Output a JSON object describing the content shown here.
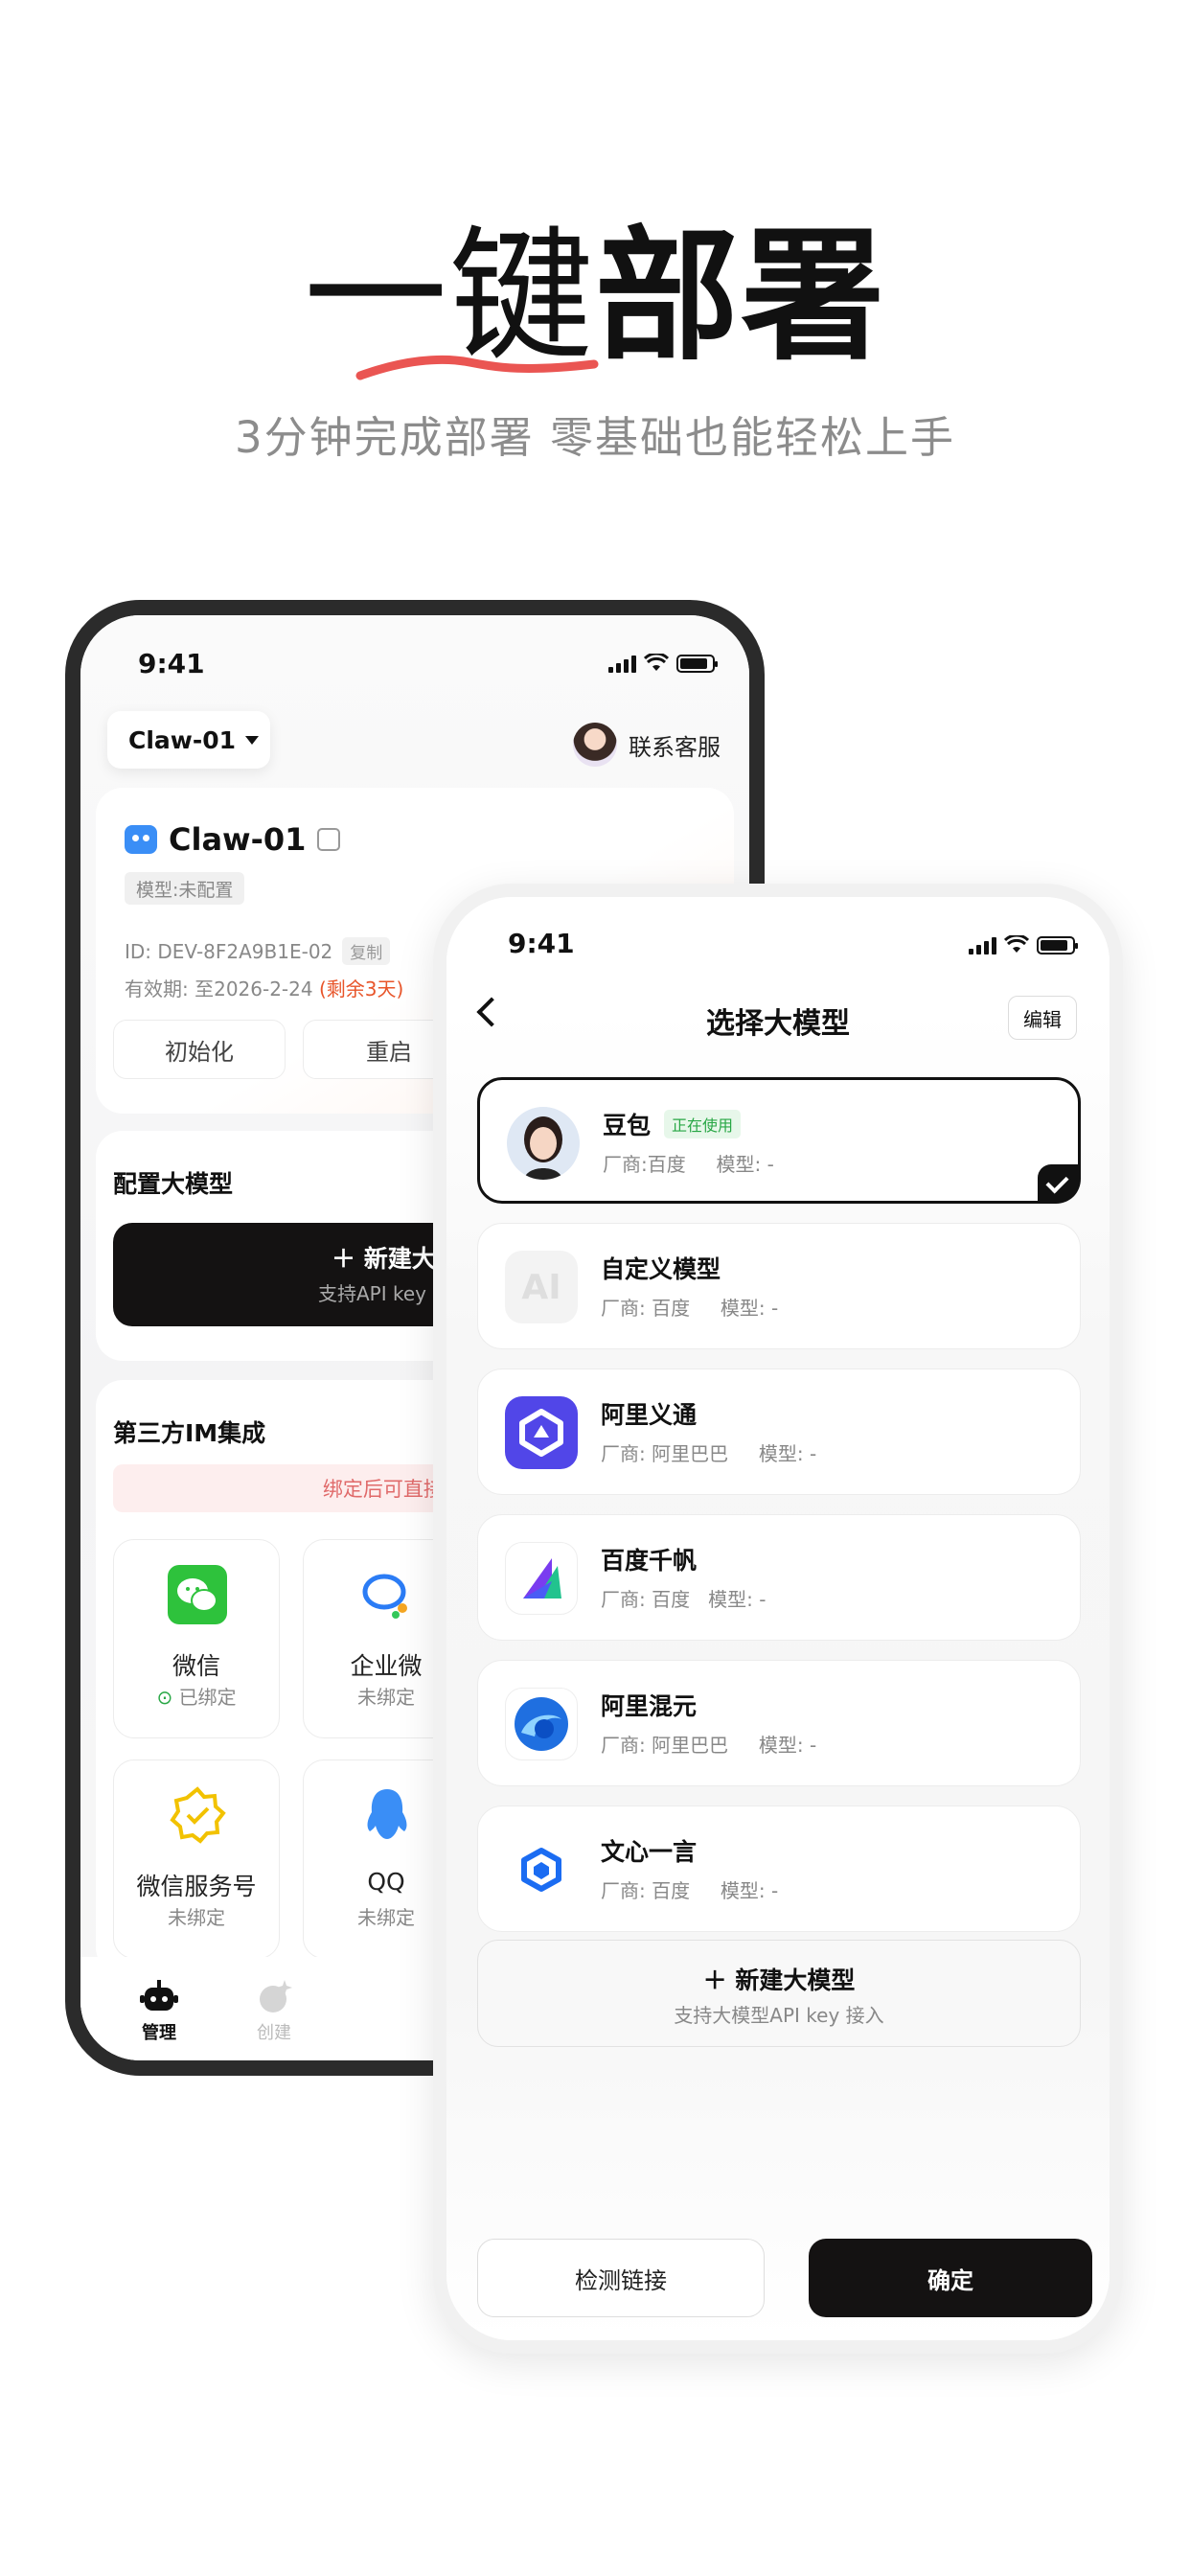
{
  "hero": {
    "title_light": "一键",
    "title_bold": "部署",
    "subtitle": "3分钟完成部署 零基础也能轻松上手"
  },
  "status_bar": {
    "time": "9:41"
  },
  "dashboard": {
    "device_selector": "Claw-01",
    "support_label": "联系客服",
    "device_name": "Claw-01",
    "model_tag": "模型:未配置",
    "device_id": "ID: DEV-8F2A9B1E-02",
    "copy_label": "复制",
    "expiry_prefix": "有效期: 至2026-2-24",
    "expiry_remaining": "(剩余3天)",
    "btn_init": "初始化",
    "btn_restart": "重启",
    "config_title": "配置大模型",
    "new_model_label": "新建大",
    "new_model_sub": "支持API key",
    "im_title": "第三方IM集成",
    "im_notice": "绑定后可直接在IM里",
    "im_items": [
      {
        "name": "微信",
        "status": "已绑定",
        "icon": "wechat-icon"
      },
      {
        "name": "企业微",
        "status": "未绑定",
        "icon": "wecom-icon"
      },
      {
        "name": "微信服务号",
        "status": "未绑定",
        "icon": "badge-check-icon"
      },
      {
        "name": "QQ",
        "status": "未绑定",
        "icon": "qq-icon"
      }
    ],
    "tabs": [
      {
        "label": "管理",
        "icon": "robot-icon"
      },
      {
        "label": "创建",
        "icon": "sparkle-icon"
      }
    ]
  },
  "model_picker": {
    "title": "选择大模型",
    "edit_label": "编辑",
    "models": [
      {
        "name": "豆包",
        "badge": "正在使用",
        "meta": "厂商:百度     模型: -",
        "selected": true,
        "icon": "doubao-avatar-icon"
      },
      {
        "name": "自定义模型",
        "meta": "厂商: 百度     模型: -",
        "icon": "ai-placeholder-icon"
      },
      {
        "name": "阿里义通",
        "meta": "厂商: 阿里巴巴     模型: -",
        "icon": "qwen-icon"
      },
      {
        "name": "百度千帆",
        "meta": "厂商: 百度   模型: -",
        "icon": "qianfan-icon"
      },
      {
        "name": "阿里混元",
        "meta": "厂商: 阿里巴巴     模型: -",
        "icon": "hunyuan-icon"
      },
      {
        "name": "文心一言",
        "meta": "厂商: 百度     模型: -",
        "icon": "wenxin-icon"
      }
    ],
    "new_model_title": "新建大模型",
    "new_model_sub": "支持大模型API key 接入",
    "btn_test": "检测链接",
    "btn_confirm": "确定"
  },
  "colors": {
    "accent_dark": "#141212",
    "warning": "#e8552a",
    "success": "#28a745",
    "brush_red": "#e8433f"
  }
}
